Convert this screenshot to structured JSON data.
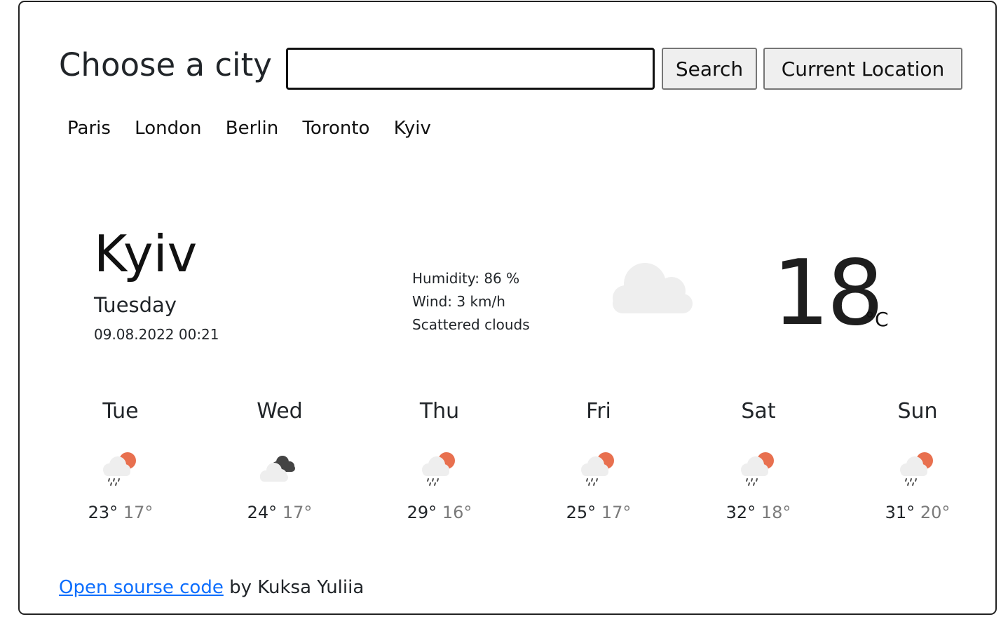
{
  "search": {
    "label": "Choose a city",
    "input_value": "",
    "search_button": "Search",
    "location_button": "Current Location"
  },
  "quick_cities": [
    "Paris",
    "London",
    "Berlin",
    "Toronto",
    "Kyiv"
  ],
  "current": {
    "city": "Kyiv",
    "weekday": "Tuesday",
    "datetime": "09.08.2022 00:21",
    "humidity": "Humidity: 86 %",
    "wind": "Wind: 3 km/h",
    "description": "Scattered clouds",
    "icon": "cloud-icon",
    "temperature": "18",
    "unit": "°C"
  },
  "forecast": [
    {
      "day": "Tue",
      "max": "23°",
      "min": "17°",
      "icon": "rain-sun-icon"
    },
    {
      "day": "Wed",
      "max": "24°",
      "min": "17°",
      "icon": "broken-clouds-icon"
    },
    {
      "day": "Thu",
      "max": "29°",
      "min": "16°",
      "icon": "rain-sun-icon"
    },
    {
      "day": "Fri",
      "max": "25°",
      "min": "17°",
      "icon": "rain-sun-icon"
    },
    {
      "day": "Sat",
      "max": "32°",
      "min": "18°",
      "icon": "rain-sun-icon"
    },
    {
      "day": "Sun",
      "max": "31°",
      "min": "20°",
      "icon": "rain-sun-icon"
    }
  ],
  "footer": {
    "link_text": "Open sourse code",
    "suffix": " by Kuksa Yuliia"
  },
  "colors": {
    "link": "#0d6efd",
    "sun": "#e8704f",
    "cloud_light": "#eeeeee",
    "cloud_dark": "#444444",
    "min_temp": "#7a7a7a"
  }
}
